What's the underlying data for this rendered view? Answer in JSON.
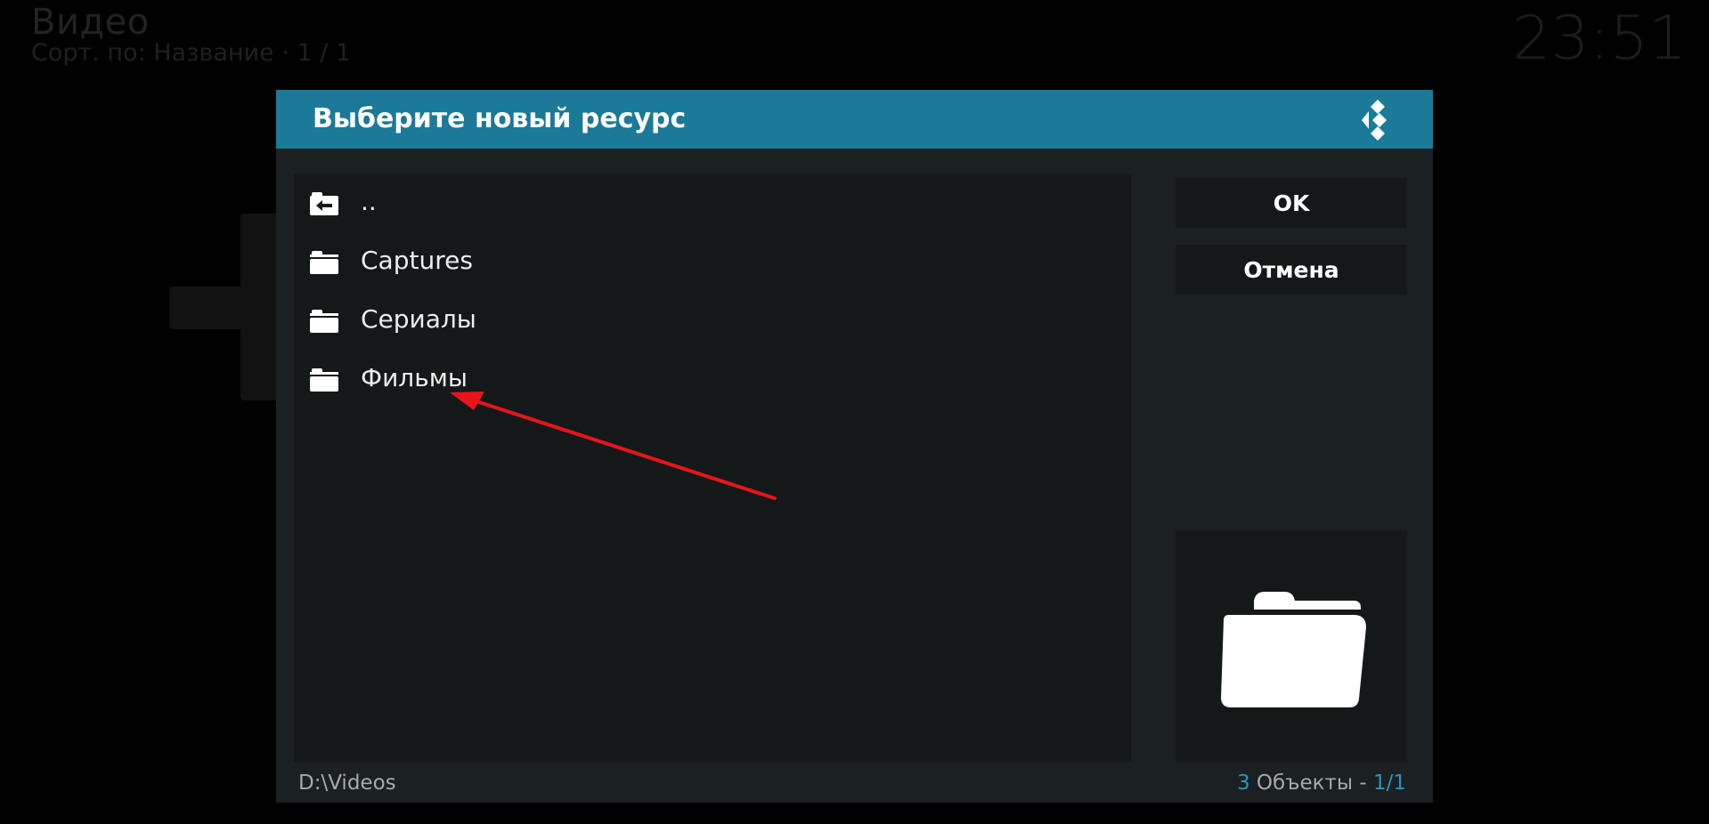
{
  "background": {
    "title": "Видео",
    "sort_text": "Сорт. по: Название  ·  1 / 1",
    "clock": "23:51"
  },
  "dialog": {
    "title": "Выберите новый ресурс",
    "logo_icon": "kodi-logo-icon",
    "accent_color": "#1a7a97",
    "items": [
      {
        "label": "..",
        "icon": "folder-back-icon"
      },
      {
        "label": "Captures",
        "icon": "folder-icon"
      },
      {
        "label": "Сериалы",
        "icon": "folder-icon"
      },
      {
        "label": "Фильмы",
        "icon": "folder-icon"
      }
    ],
    "buttons": {
      "ok_label": "OK",
      "cancel_label": "Отмена"
    },
    "preview_icon": "folder-open-icon",
    "path": "D:\\Videos",
    "status": {
      "count": "3",
      "objects_label": "Объекты",
      "separator": "-",
      "page": "1/1"
    }
  },
  "annotation": {
    "arrow_color": "#e8141b",
    "arrow_icon": "red-arrow-annotation"
  }
}
